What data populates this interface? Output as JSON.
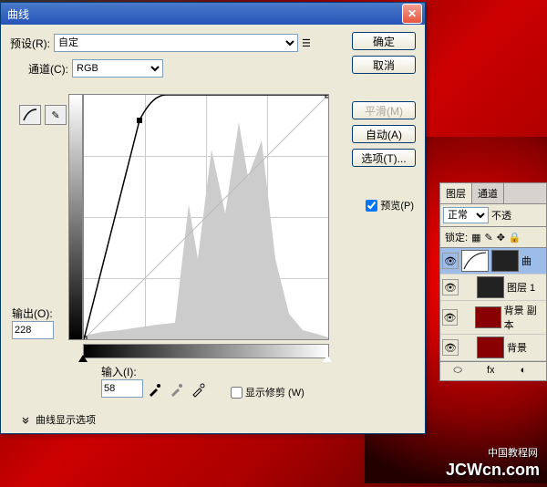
{
  "dialog": {
    "title": "曲线",
    "preset_label": "预设(R):",
    "preset_value": "自定",
    "channel_label": "通道(C):",
    "channel_value": "RGB",
    "output_label": "输出(O):",
    "output_value": "228",
    "input_label": "输入(I):",
    "input_value": "58",
    "show_clip": "显示修剪 (W)",
    "curve_options": "曲线显示选项",
    "curve_point": {
      "x": 58,
      "y": 228
    }
  },
  "buttons": {
    "ok": "确定",
    "cancel": "取消",
    "smooth": "平滑(M)",
    "auto": "自动(A)",
    "options": "选项(T)...",
    "preview": "预览(P)"
  },
  "layers_panel": {
    "tab_layers": "图层",
    "tab_channels": "通道",
    "blend_mode": "正常",
    "opacity_label": "不透",
    "lock_label": "锁定:",
    "items": [
      {
        "name": "曲",
        "type": "curves"
      },
      {
        "name": "图层 1",
        "type": "bw"
      },
      {
        "name": "背景 副本",
        "type": "rose"
      },
      {
        "name": "背景",
        "type": "rose"
      }
    ]
  },
  "watermark": {
    "cn": "中国教程网",
    "en": "JCWcn.com"
  },
  "chart_data": {
    "type": "curves",
    "title": "曲线",
    "x_range": [
      0,
      255
    ],
    "y_range": [
      0,
      255
    ],
    "points": [
      {
        "x": 0,
        "y": 0
      },
      {
        "x": 58,
        "y": 228
      },
      {
        "x": 86,
        "y": 255
      },
      {
        "x": 255,
        "y": 255
      }
    ],
    "histogram_peaks": [
      140,
      160,
      180,
      115,
      170,
      120,
      150
    ],
    "xlabel": "输入",
    "ylabel": "输出"
  }
}
